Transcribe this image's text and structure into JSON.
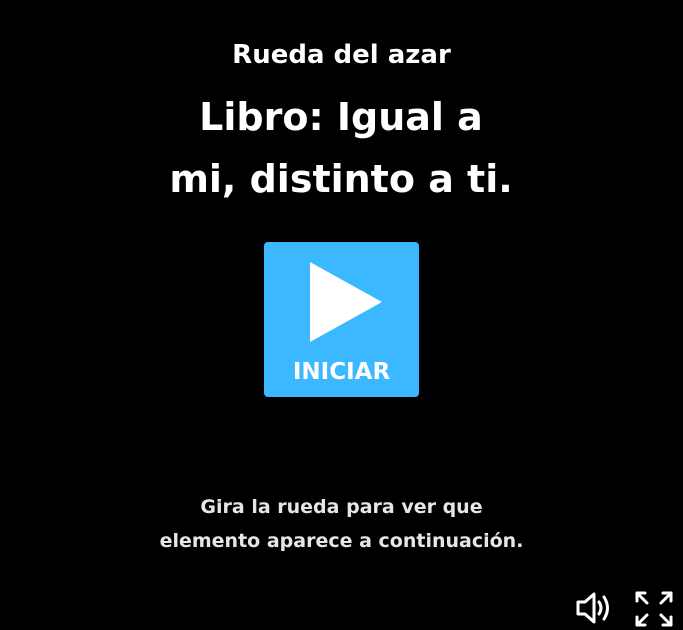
{
  "activity": {
    "type_label": "Rueda del azar",
    "title_line1": "Libro: Igual a",
    "title_line2": "mi, distinto a ti."
  },
  "start_button": {
    "label": "INICIAR",
    "icon": "play-icon",
    "color": "#3bb8ff"
  },
  "instructions": {
    "line1": "Gira la rueda para ver que",
    "line2": "elemento aparece a continuación."
  },
  "controls": {
    "sound_icon": "speaker-icon",
    "fullscreen_icon": "fullscreen-icon"
  },
  "colors": {
    "background": "#000000",
    "text": "#ffffff",
    "accent": "#3bb8ff"
  }
}
